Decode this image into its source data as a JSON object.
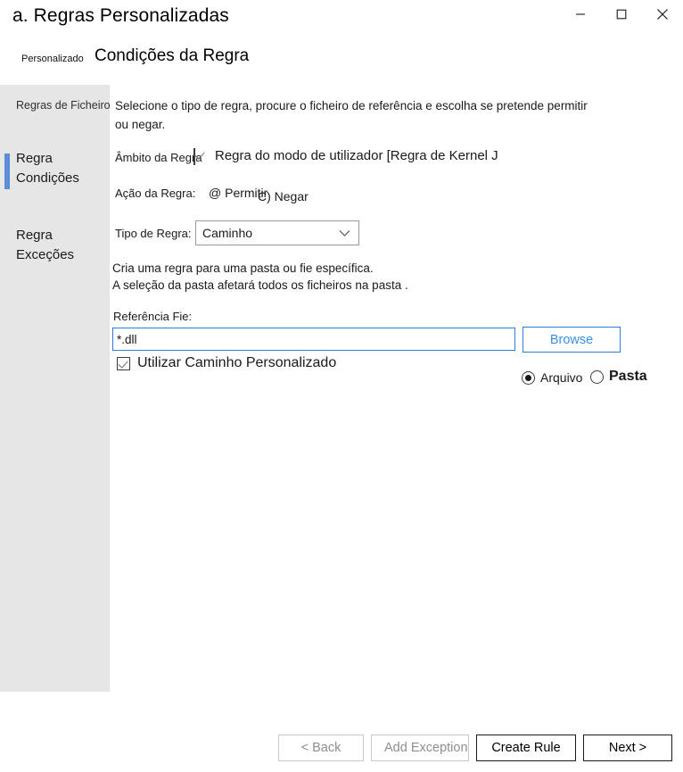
{
  "window": {
    "title": "a. Regras Personalizadas",
    "controls": {
      "minimize": "minimize-icon",
      "maximize": "maximize-icon",
      "close": "close-icon"
    }
  },
  "header": {
    "breadcrumb_small": "Personalizado",
    "page_heading": "Condições da Regra"
  },
  "sidebar": {
    "items": [
      {
        "label": "Regras de Ficheiro",
        "selected": false
      },
      {
        "label": "Regra Condições",
        "selected": true
      },
      {
        "label": "Regra Exceções",
        "selected": false
      }
    ]
  },
  "main": {
    "intro": "Selecione o tipo de regra, procure o ficheiro de referência e escolha se pretende permitir ou negar.",
    "rule_scope": {
      "label": "Âmbito da Regra",
      "checkbox_checked": true,
      "text": "Regra do modo de utilizador [Regra de Kernel J"
    },
    "rule_action": {
      "label": "Ação da Regra:",
      "allow": "@ Permitir",
      "deny": "C) Negar"
    },
    "rule_type": {
      "label": "Tipo de Regra:",
      "value": "Caminho",
      "options": [
        "Caminho"
      ]
    },
    "description": "Cria uma regra para uma pasta ou fie específica.\nA seleção da pasta afetará todos os ficheiros na pasta .",
    "reference": {
      "label": "Referência  Fie:",
      "value": "*.dll",
      "placeholder": "",
      "browse_label": "Browse"
    },
    "custom_path": {
      "label": "Utilizar Caminho Personalizado",
      "checked": true
    },
    "target": {
      "file_label": "Arquivo",
      "folder_label": "Pasta",
      "selected": "file"
    }
  },
  "footer": {
    "back": "< Back",
    "add_exception": "Add Exception",
    "create_rule": "Create Rule",
    "next": "Next >"
  },
  "colors": {
    "sidebar_bg": "#e6e6e6",
    "accent_selected": "#5b8ed6",
    "link_blue": "#3b90e6",
    "focus_border": "#2b7fd4"
  }
}
